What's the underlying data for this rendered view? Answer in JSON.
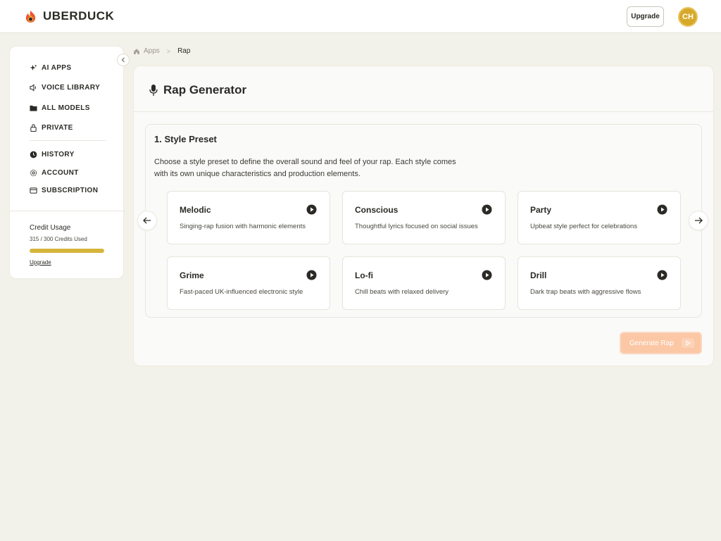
{
  "app": {
    "name": "UBERDUCK"
  },
  "header": {
    "upgrade_label": "Upgrade",
    "avatar_initials": "CH"
  },
  "sidebar": {
    "items": [
      {
        "label": "AI APPS",
        "icon": "sparkle-icon"
      },
      {
        "label": "VOICE LIBRARY",
        "icon": "speaker-icon"
      },
      {
        "label": "ALL MODELS",
        "icon": "folder-icon"
      },
      {
        "label": "PRIVATE",
        "icon": "lock-icon"
      },
      {
        "label": "HISTORY",
        "icon": "clock-icon"
      },
      {
        "label": "ACCOUNT",
        "icon": "gear-icon"
      },
      {
        "label": "SUBSCRIPTION",
        "icon": "card-icon"
      }
    ],
    "credit": {
      "title": "Credit Usage",
      "used_text": "315 / 300 Credits Used",
      "fill_fraction": 1.0,
      "upgrade_link": "Upgrade"
    }
  },
  "breadcrumb": {
    "apps": "Apps",
    "separator": ">",
    "current": "Rap"
  },
  "main": {
    "title": "Rap Generator",
    "section": {
      "title": "1. Style Preset",
      "description": "Choose a style preset to define the overall sound and feel of your rap. Each style comes with its own unique characteristics and production elements.",
      "presets": [
        {
          "name": "Melodic",
          "description": "Singing-rap fusion with harmonic elements"
        },
        {
          "name": "Conscious",
          "description": "Thoughtful lyrics focused on social issues"
        },
        {
          "name": "Party",
          "description": "Upbeat style perfect for celebrations"
        },
        {
          "name": "Grime",
          "description": "Fast-paced UK-influenced electronic style"
        },
        {
          "name": "Lo-fi",
          "description": "Chill beats with relaxed delivery"
        },
        {
          "name": "Drill",
          "description": "Dark trap beats with aggressive flows"
        }
      ]
    },
    "generate_label": "Generate Rap"
  },
  "colors": {
    "accent": "#fbc7a5",
    "credit_bar": "#d7b43c",
    "avatar": "#d6a92a",
    "background": "#f3f2ea"
  }
}
